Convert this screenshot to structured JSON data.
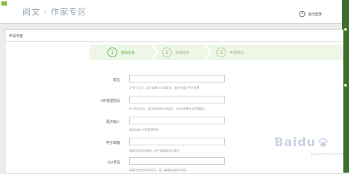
{
  "header": {
    "brand_title": "阅文 · 作家专区",
    "logout_label": "退出登录"
  },
  "panel": {
    "title": "申请作者"
  },
  "steps": [
    {
      "num": "1",
      "label": "基础信息",
      "active": true
    },
    {
      "num": "2",
      "label": "详细信息",
      "active": false
    },
    {
      "num": "3",
      "label": "申请成功",
      "active": false
    }
  ],
  "form": {
    "fields": [
      {
        "label": "笔名",
        "value": "",
        "hint": "2~8个汉字，英文或数字字母组成，笔名申请后不可变更"
      },
      {
        "label": "VIP管理密码",
        "value": "",
        "hint": "6~16位英文、数字或特殊字符组成，支持VIP章节对签署输入"
      },
      {
        "label": "再次输入",
        "value": "",
        "hint": "请再次输入VIP管理密码"
      },
      {
        "label": "电子邮箱",
        "value": "",
        "hint": "请填写常用的邮箱，便于编辑联系及找回"
      },
      {
        "label": "QQ号码",
        "value": "",
        "hint": "请填写常用的QQ号码，便于编辑快速联系到您"
      }
    ]
  },
  "watermark": {
    "brand": "Baidu",
    "sub": "jingyan.baidu.com"
  },
  "colors": {
    "accent_green": "#6ab04c",
    "step_bg": "#eef7e6",
    "title_grey": "#9aa7b3"
  }
}
